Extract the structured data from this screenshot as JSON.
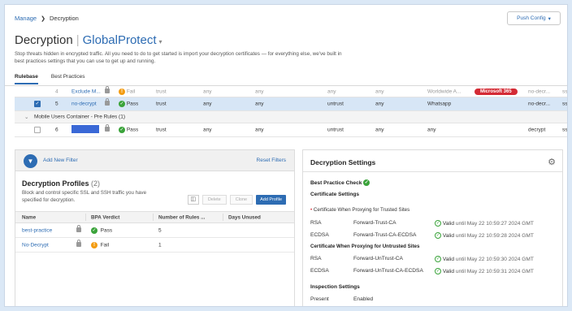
{
  "breadcrumb": {
    "parent": "Manage",
    "current": "Decryption"
  },
  "push_config": "Push Config",
  "page": {
    "title": "Decryption",
    "scope": "GlobalProtect",
    "description": "Stop threats hidden in encrypted traffic. All you need to do to get started is import your decryption certificates — for everything else, we've built in best practices settings that you can use to get up and running."
  },
  "tabs": [
    "Rulebase",
    "Best Practices"
  ],
  "rules": {
    "row1": {
      "num": "4",
      "name": "Exclude M...",
      "verdict": "Fail",
      "from": "trust",
      "src": "any",
      "user": "any",
      "to": "any",
      "dst": "any",
      "category": "Worldwide A...",
      "badge": "Microsoft 365",
      "action": "no-decr...",
      "type": "ssl"
    },
    "row2": {
      "num": "5",
      "name": "no-decrypt",
      "verdict": "Pass",
      "from": "trust",
      "src": "any",
      "user": "any",
      "to": "untrust",
      "dst": "any",
      "category": "Whatsapp",
      "action": "no-decr...",
      "type": "ssl"
    },
    "container": "Mobile Users Container - Pre Rules (1)",
    "row4": {
      "num": "6",
      "verdict": "Pass",
      "from": "trust",
      "src": "any",
      "user": "any",
      "to": "untrust",
      "dst": "any",
      "category": "any",
      "action": "decrypt",
      "type": "ssl"
    }
  },
  "filters": {
    "add": "Add New Filter",
    "reset": "Reset Filters"
  },
  "profiles": {
    "title": "Decryption Profiles",
    "count": "(2)",
    "description": "Block and control specific SSL and SSH traffic you have specified for decryption.",
    "buttons": {
      "delete": "Delete",
      "clone": "Clone",
      "add": "Add Profile"
    },
    "columns": [
      "Name",
      "BPA Verdict",
      "Number of Rules ...",
      "Days Unused"
    ],
    "rows": [
      {
        "name": "best-practice",
        "verdict": "Pass",
        "rules": "5",
        "days": ""
      },
      {
        "name": "No-Decrypt",
        "verdict": "Fail",
        "rules": "1",
        "days": ""
      }
    ]
  },
  "settings": {
    "title": "Decryption Settings",
    "bpc": "Best Practice Check",
    "cert_title": "Certificate Settings",
    "trusted_title": "Certificate When Proxying for Trusted Sites",
    "trusted": [
      {
        "alg": "RSA",
        "name": "Forward-Trust-CA",
        "valid": "Valid",
        "until": "until May 22 10:59:27 2024 GMT"
      },
      {
        "alg": "ECDSA",
        "name": "Forward-Trust-CA-ECDSA",
        "valid": "Valid",
        "until": "until May 22 10:59:28 2024 GMT"
      }
    ],
    "untrusted_title": "Certificate When Proxying for Untrusted Sites",
    "untrusted": [
      {
        "alg": "RSA",
        "name": "Forward-UnTrust-CA",
        "valid": "Valid",
        "until": "until May 22 10:59:30 2024 GMT"
      },
      {
        "alg": "ECDSA",
        "name": "Forward-UnTrust-CA-ECDSA",
        "valid": "Valid",
        "until": "until May 22 10:59:31 2024 GMT"
      }
    ],
    "inspection_title": "Inspection Settings",
    "inspection": {
      "label": "Present",
      "value": "Enabled"
    }
  },
  "colors": {
    "accent": "#2d6cb3",
    "pass": "#3aa33a",
    "fail": "#f39c12",
    "badge": "#d42b35",
    "selected_row": "#d7e6f6"
  }
}
